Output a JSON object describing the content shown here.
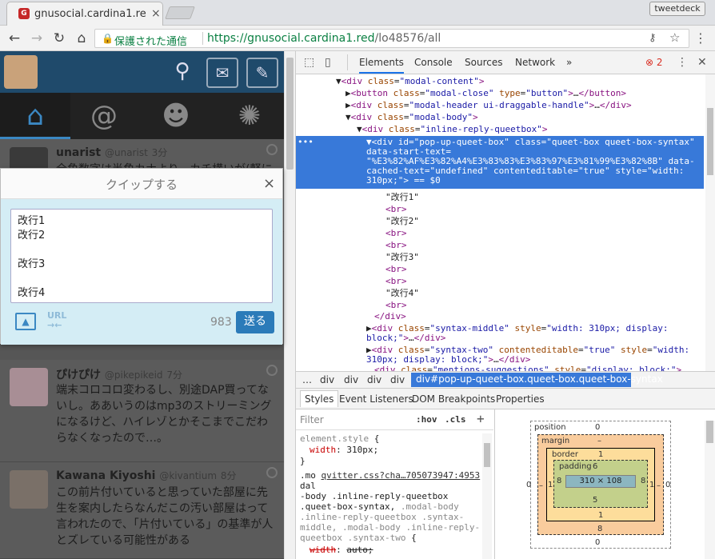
{
  "browser": {
    "tab_title": "gnusocial.cardina1.red",
    "favicon_label": "G",
    "tab_close": "×",
    "profile_button": "tweetdeck",
    "security_label": "保護された通信",
    "url_host": "https://gnusocial.cardina1.red",
    "url_path": "/lo48576/all",
    "back": "←",
    "forward": "→",
    "reload": "↻",
    "home": "⌂",
    "key_icon": "⚷",
    "star_icon": "☆",
    "menu": "⋮"
  },
  "app": {
    "timeline": [
      {
        "name": "unarist",
        "handle": "@unarist",
        "time": "3分",
        "text": "全角数字は半角カナより、カチ構いが(軽に"
      },
      {
        "name": "ぴけぴけ",
        "handle": "@pikepikeid",
        "time": "7分",
        "text": "端末コロコロ変わるし、別途DAP買ってないし。ああいうのはmp3のストリーミングになるけど、ハイレゾとかそこまでこだわらなくなったので…。"
      },
      {
        "name": "Kawana Kiyoshi",
        "handle": "@kivantium",
        "time": "8分",
        "text": "この前片付いていると思っていた部屋に先生を案内したらなんだこの汚い部屋はって言われたので、「片付いている」の基準が人とズレている可能性がある"
      }
    ]
  },
  "modal": {
    "title": "クイップする",
    "close": "×",
    "lines": [
      "改行1",
      "改行2",
      "",
      "改行3",
      "",
      "改行4"
    ],
    "url_label": "URL",
    "char_count": "983",
    "send_label": "送る"
  },
  "devtools": {
    "tabs": [
      "Elements",
      "Console",
      "Sources",
      "Network"
    ],
    "more": "»",
    "error_count": "2",
    "breadcrumbs": [
      "…",
      "div",
      "div",
      "div",
      "div"
    ],
    "breadcrumb_selected": "div#pop-up-queet-box.queet-box.queet-box-syntax",
    "styles_tabs": [
      "Styles",
      "Event Listeners",
      "DOM Breakpoints",
      "Properties"
    ],
    "filter_placeholder": "Filter",
    "hov": ":hov",
    "cls": ".cls",
    "box_model": {
      "position_label": "position",
      "position_val": "0",
      "margin_label": "margin",
      "margin_val": "–",
      "border_label": "border",
      "border_val": "1",
      "padding_label": "padding",
      "padding_val": "6",
      "content": "310 × 108",
      "padding_side": "8",
      "border_side": "1",
      "margin_side": "–",
      "position_side": "0",
      "padding_bottom": "5",
      "border_bottom": "1",
      "margin_bottom": "8",
      "position_bottom": "0"
    }
  },
  "colors": {
    "selected_node": "#3879d9",
    "send_button": "#2b7bb9",
    "secure_green": "#0b8043"
  }
}
